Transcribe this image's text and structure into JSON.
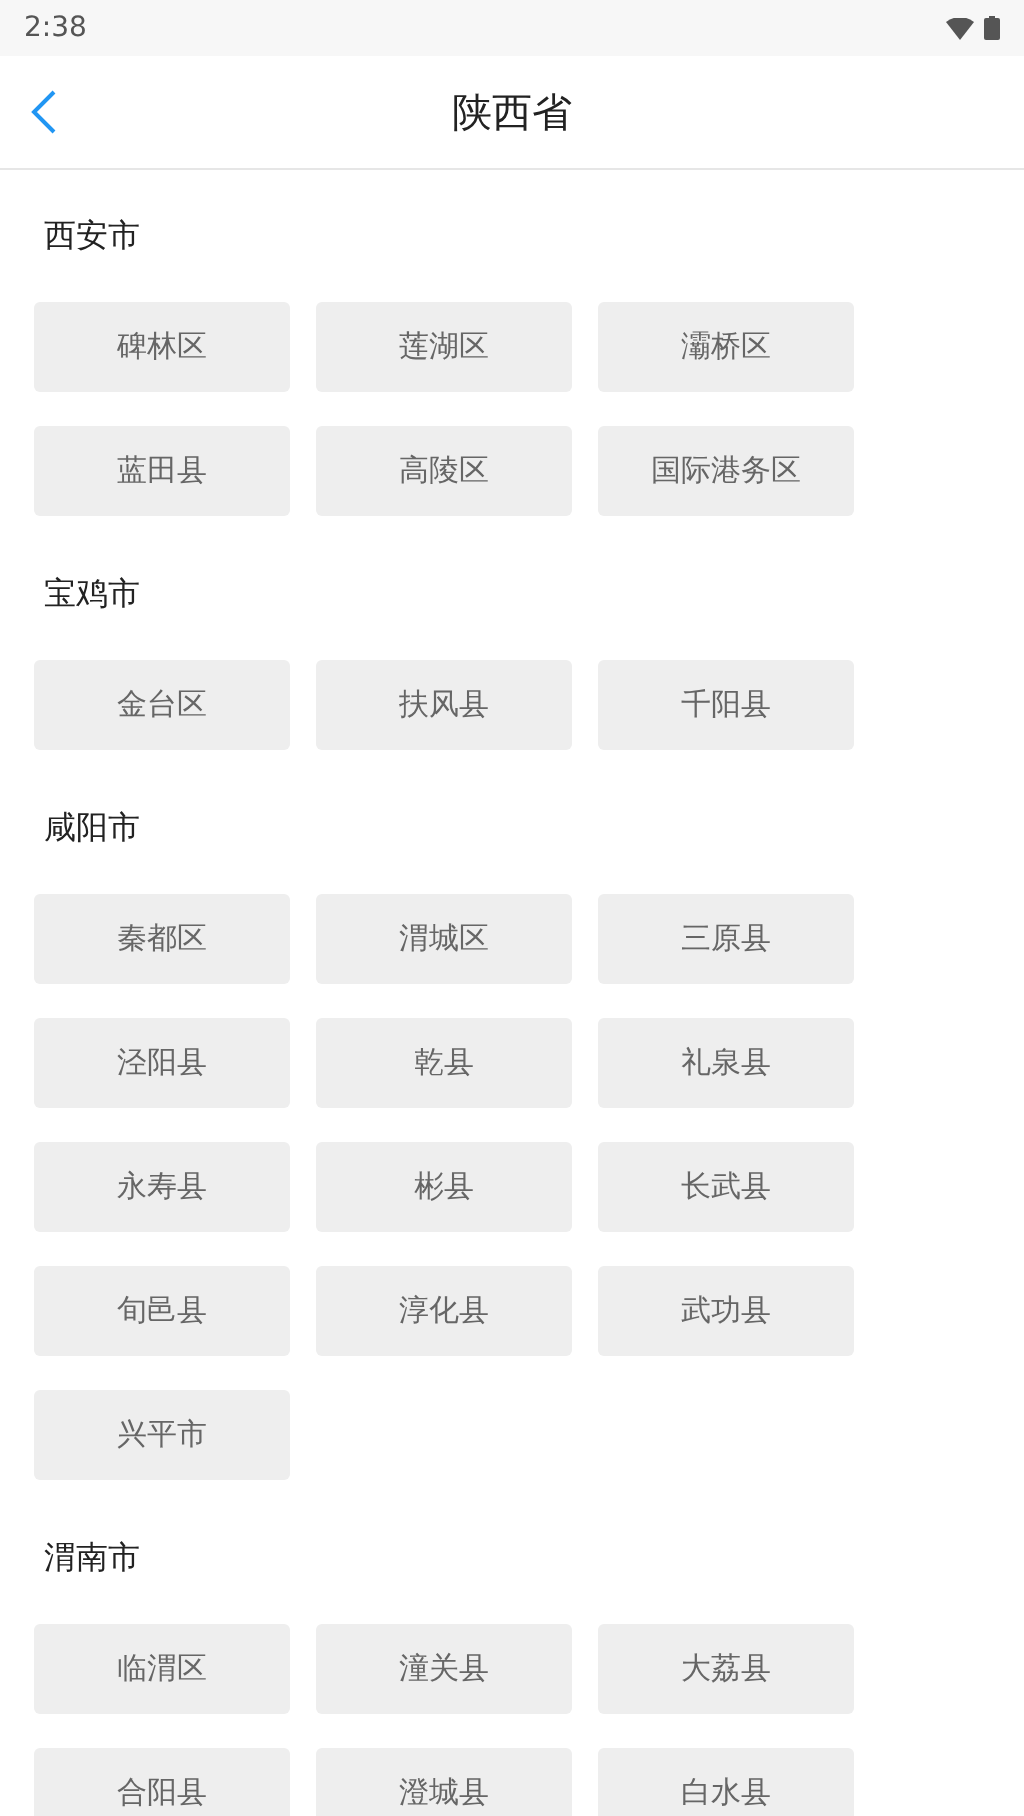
{
  "status_bar": {
    "time": "2:38"
  },
  "header": {
    "title": "陕西省"
  },
  "sections": [
    {
      "name": "西安市",
      "districts": [
        "碑林区",
        "莲湖区",
        "灞桥区",
        "蓝田县",
        "高陵区",
        "国际港务区"
      ]
    },
    {
      "name": "宝鸡市",
      "districts": [
        "金台区",
        "扶风县",
        "千阳县"
      ]
    },
    {
      "name": "咸阳市",
      "districts": [
        "秦都区",
        "渭城区",
        "三原县",
        "泾阳县",
        "乾县",
        "礼泉县",
        "永寿县",
        "彬县",
        "长武县",
        "旬邑县",
        "淳化县",
        "武功县",
        "兴平市"
      ]
    },
    {
      "name": "渭南市",
      "districts": [
        "临渭区",
        "潼关县",
        "大荔县",
        "合阳县",
        "澄城县",
        "白水县"
      ]
    }
  ]
}
